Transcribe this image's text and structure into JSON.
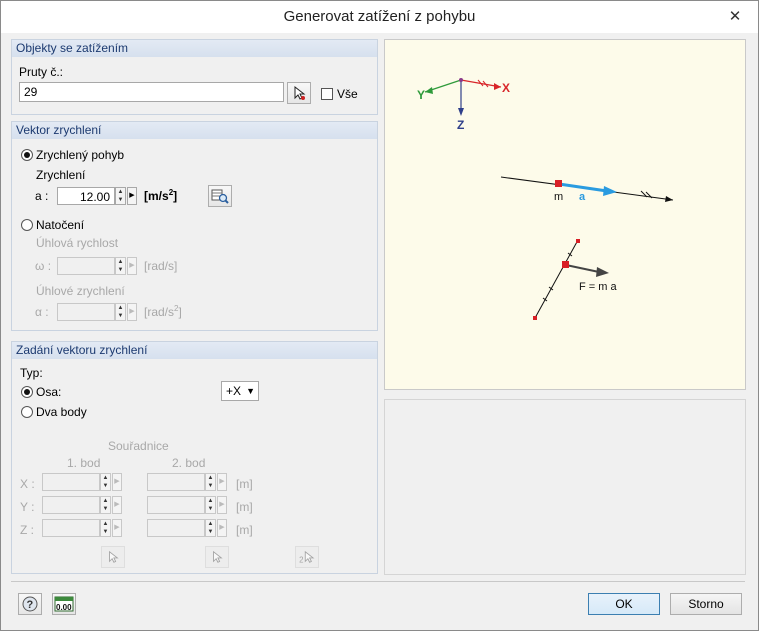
{
  "window": {
    "title": "Generovat zatížení z pohybu",
    "close_glyph": "✕"
  },
  "objects": {
    "header": "Objekty se zatížením",
    "members_label": "Pruty č.:",
    "members_value": "29",
    "all_label": "Vše",
    "all_checked": false
  },
  "accel": {
    "header": "Vektor zrychlení",
    "linear_label": "Zrychlený pohyb",
    "acceleration_label": "Zrychlení",
    "a_label": "a :",
    "a_value": "12.00",
    "a_unit": "[m/s",
    "a_unit_exp": "2",
    "a_unit_close": "]",
    "rotation_label": "Natočení",
    "angvel_label": "Úhlová rychlost",
    "omega_label": "ω :",
    "omega_unit": "[rad/s]",
    "angacc_label": "Úhlové zrychlení",
    "alpha_label": "α :",
    "alpha_unit": "[rad/s",
    "alpha_unit_exp": "2",
    "alpha_unit_close": "]",
    "selected": "linear"
  },
  "vector": {
    "header": "Zadání vektoru zrychlení",
    "type_label": "Typ:",
    "axis_label": "Osa:",
    "two_points_label": "Dva body",
    "axis_value": "+X",
    "selected": "axis",
    "coords_label": "Souřadnice",
    "point1_label": "1. bod",
    "point2_label": "2. bod",
    "x_label": "X :",
    "y_label": "Y :",
    "z_label": "Z :",
    "unit": "[m]"
  },
  "preview": {
    "axis_x": "X",
    "axis_y": "Y",
    "axis_z": "Z",
    "mass_label": "m",
    "accel_label": "a",
    "force_label": "F = m a"
  },
  "footer": {
    "ok_label": "OK",
    "cancel_label": "Storno",
    "units_icon_text": "0.00"
  },
  "colors": {
    "group_header_text": "#1c3a70",
    "preview_bg": "#fdfbea",
    "axis_x": "#d8262a",
    "axis_y": "#2e9a3a",
    "axis_z": "#2f3f8a",
    "accel_arrow": "#2a9be0",
    "mass": "#d81f26"
  }
}
